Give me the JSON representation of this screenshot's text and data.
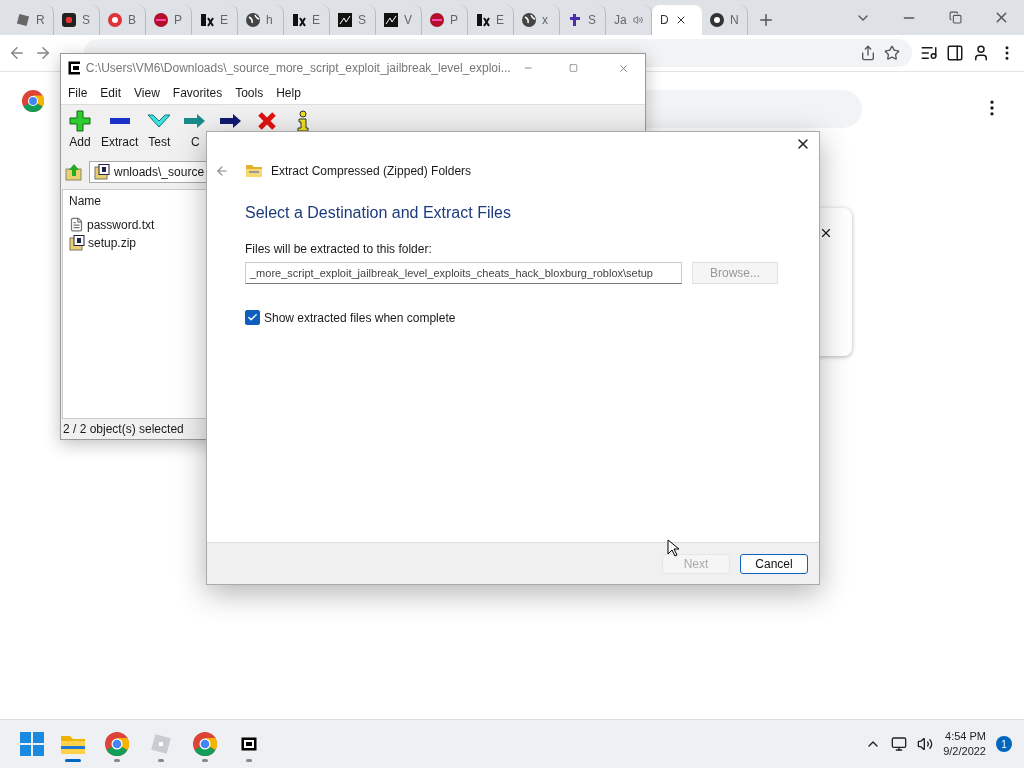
{
  "browser": {
    "tabs": [
      {
        "kind": "roblox",
        "label": "R",
        "selected": false,
        "playing": false
      },
      {
        "kind": "s",
        "label": "S",
        "selected": false,
        "playing": false
      },
      {
        "kind": "bubble",
        "label": "B",
        "selected": false,
        "playing": false
      },
      {
        "kind": "ball",
        "label": "P",
        "selected": false,
        "playing": false
      },
      {
        "kind": "ex",
        "label": "E",
        "selected": false,
        "playing": false
      },
      {
        "kind": "globe",
        "label": "h",
        "selected": false,
        "playing": false
      },
      {
        "kind": "ex",
        "label": "E",
        "selected": false,
        "playing": false
      },
      {
        "kind": "spark",
        "label": "S",
        "selected": false,
        "playing": false
      },
      {
        "kind": "spark",
        "label": "V",
        "selected": false,
        "playing": false
      },
      {
        "kind": "ball",
        "label": "P",
        "selected": false,
        "playing": false
      },
      {
        "kind": "ex",
        "label": "E",
        "selected": false,
        "playing": false
      },
      {
        "kind": "globe",
        "label": "x",
        "selected": false,
        "playing": false
      },
      {
        "kind": "t",
        "label": "S",
        "selected": false,
        "playing": false
      },
      {
        "kind": "none",
        "label": "Ja",
        "selected": false,
        "playing": true
      },
      {
        "kind": "none",
        "label": "D",
        "selected": true,
        "playing": false
      },
      {
        "kind": "chrome",
        "label": "N",
        "selected": false,
        "playing": false
      }
    ]
  },
  "sevenzip": {
    "title": "C:\\Users\\VM6\\Downloads\\_source_more_script_exploit_jailbreak_level_exploi...",
    "menu": [
      "File",
      "Edit",
      "View",
      "Favorites",
      "Tools",
      "Help"
    ],
    "toolbar": [
      {
        "kind": "add",
        "label": "Add"
      },
      {
        "kind": "extract",
        "label": "Extract"
      },
      {
        "kind": "test",
        "label": "Test"
      },
      {
        "kind": "copy",
        "label": "C"
      },
      {
        "kind": "move"
      },
      {
        "kind": "delete"
      },
      {
        "kind": "info"
      }
    ],
    "path": "wnloads\\_source",
    "column": "Name",
    "files": [
      {
        "kind": "text",
        "name": "password.txt"
      },
      {
        "kind": "zip",
        "name": "setup.zip"
      }
    ],
    "status": "2 / 2 object(s) selected"
  },
  "dialog": {
    "title": "Extract Compressed (Zipped) Folders",
    "heading": "Select a Destination and Extract Files",
    "field_label": "Files will be extracted to this folder:",
    "destination": "_more_script_exploit_jailbreak_level_exploits_cheats_hack_bloxburg_roblox\\setup",
    "browse": {
      "label": "Browse...",
      "disabled": true
    },
    "show_files": {
      "label": "Show extracted files when complete",
      "checked": true
    },
    "buttons": [
      {
        "label": "Next",
        "disabled": true
      },
      {
        "label": "Cancel",
        "disabled": false
      }
    ]
  },
  "taskbar": {
    "apps": [
      {
        "kind": "explorer",
        "active": true
      },
      {
        "kind": "chrome",
        "active": false
      },
      {
        "kind": "roblox",
        "active": false
      },
      {
        "kind": "chrome",
        "active": false
      },
      {
        "kind": "sevenzip",
        "active": false
      }
    ],
    "time": "4:54 PM",
    "date": "9/2/2022",
    "notifications": "1"
  }
}
